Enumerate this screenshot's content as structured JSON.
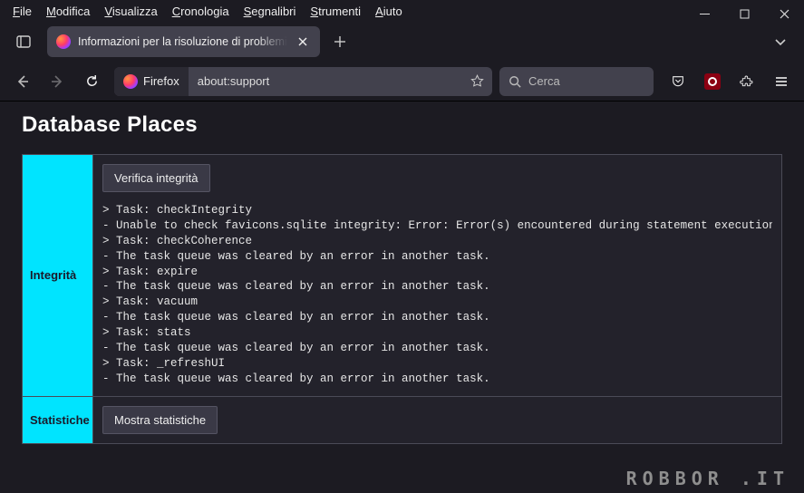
{
  "menu": {
    "file": "File",
    "edit": "Modifica",
    "view": "Visualizza",
    "history": "Cronologia",
    "bookmarks": "Segnalibri",
    "tools": "Strumenti",
    "help": "Aiuto"
  },
  "tab": {
    "title": "Informazioni per la risoluzione di problemi"
  },
  "urlbar": {
    "identity_label": "Firefox",
    "url": "about:support"
  },
  "searchbar": {
    "placeholder": "Cerca"
  },
  "page": {
    "heading": "Database Places"
  },
  "table": {
    "row1": {
      "header": "Integrità",
      "button": "Verifica integrità",
      "log": "> Task: checkIntegrity\n- Unable to check favicons.sqlite integrity: Error: Error(s) encountered during statement execution:\n> Task: checkCoherence\n- The task queue was cleared by an error in another task.\n> Task: expire\n- The task queue was cleared by an error in another task.\n> Task: vacuum\n- The task queue was cleared by an error in another task.\n> Task: stats\n- The task queue was cleared by an error in another task.\n> Task: _refreshUI\n- The task queue was cleared by an error in another task."
    },
    "row2": {
      "header": "Statistiche",
      "button": "Mostra statistiche"
    }
  },
  "watermark": "ROBBOR .IT"
}
